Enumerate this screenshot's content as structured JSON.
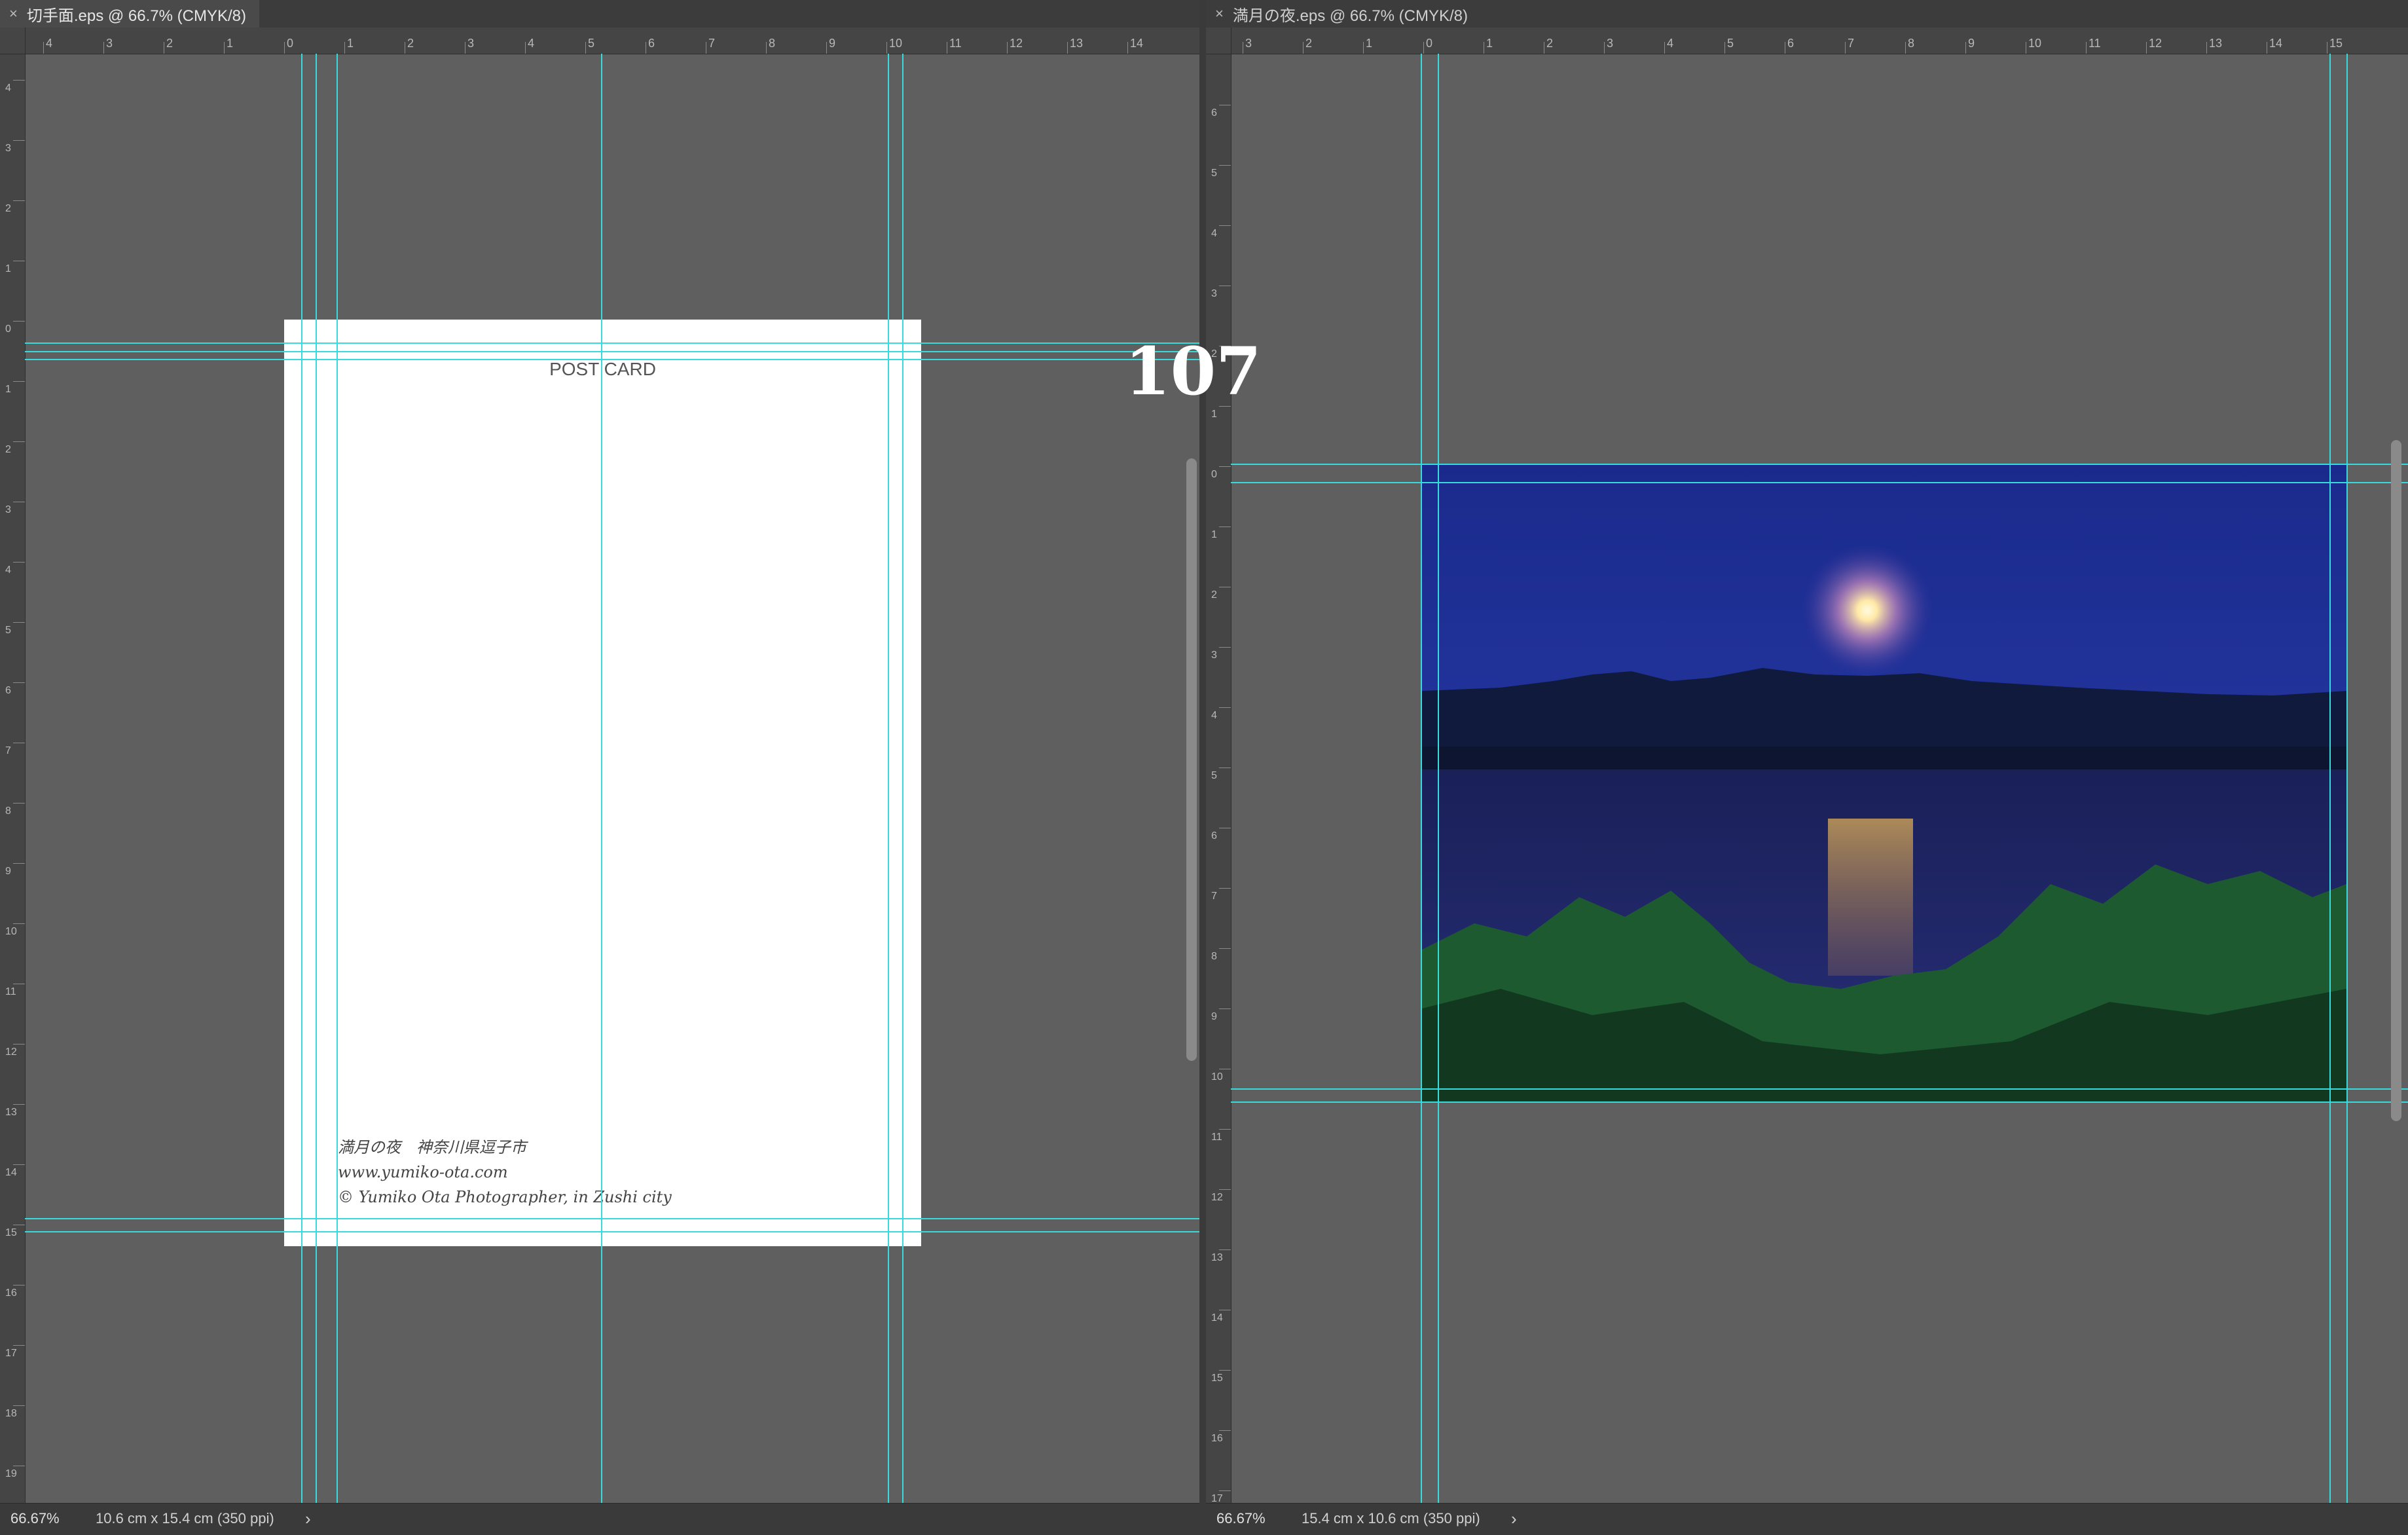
{
  "left_doc": {
    "tab_title": "切手面.eps @ 66.7% (CMYK/8)",
    "close_symbol": "×",
    "zoom": "66.67%",
    "dimensions": "10.6 cm x 15.4 cm (350 ppi)",
    "status_arrow": "›",
    "ruler_h_labels": [
      "4",
      "3",
      "2",
      "1",
      "0",
      "1",
      "2",
      "3",
      "4",
      "5",
      "6",
      "7",
      "8",
      "9",
      "10",
      "11",
      "12",
      "13",
      "14"
    ],
    "ruler_v_labels": [
      "4",
      "3",
      "2",
      "1",
      "0",
      "1",
      "2",
      "3",
      "4",
      "5",
      "6",
      "7",
      "8",
      "9",
      "10",
      "11",
      "12",
      "13",
      "14",
      "15",
      "16",
      "17",
      "18",
      "19"
    ],
    "postcard": {
      "title": "POST CARD",
      "credit_line1": "満月の夜　神奈川県逗子市",
      "credit_line2": "www.yumiko-ota.com",
      "credit_line3": "© Yumiko Ota Photographer, in Zushi city"
    }
  },
  "right_doc": {
    "tab_title": "満月の夜.eps @ 66.7% (CMYK/8)",
    "close_symbol": "×",
    "zoom": "66.67%",
    "dimensions": "15.4 cm x 10.6 cm (350 ppi)",
    "status_arrow": "›",
    "ruler_h_labels": [
      "3",
      "2",
      "1",
      "0",
      "1",
      "2",
      "3",
      "4",
      "5",
      "6",
      "7",
      "8",
      "9",
      "10",
      "11",
      "12",
      "13",
      "14",
      "15"
    ],
    "ruler_v_labels": [
      "6",
      "5",
      "4",
      "3",
      "2",
      "1",
      "0",
      "1",
      "2",
      "3",
      "4",
      "5",
      "6",
      "7",
      "8",
      "9",
      "10",
      "11",
      "12",
      "13",
      "14",
      "15",
      "16",
      "17"
    ]
  },
  "overlay_number": "107",
  "colors": {
    "guide": "#37dbdb",
    "canvas_bg": "#5f5f5f",
    "sky": "#1a2c8a",
    "water": "#1c2660"
  }
}
